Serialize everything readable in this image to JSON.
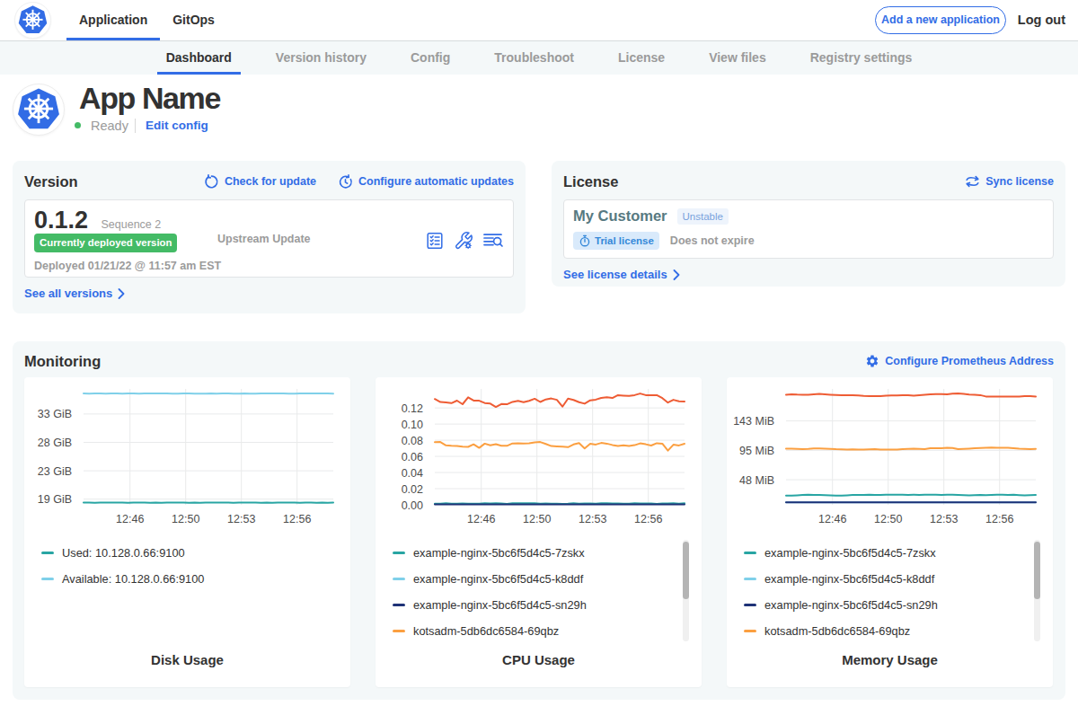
{
  "colors": {
    "accent_blue": "#326de6",
    "k8s_blue": "#326ce5",
    "green": "#44bb66",
    "card_bg": "#f4f8f9",
    "text_dark": "#323232",
    "text_gray": "#9b9b9b",
    "teal": "#28a5a3",
    "light_blue": "#7fd0e9",
    "navy": "#1e3277",
    "orange": "#fb9f40",
    "red_orange": "#ee5c34"
  },
  "topnav": {
    "logo_icon": "kubernetes-logo",
    "tabs": [
      {
        "label": "Application",
        "active": true
      },
      {
        "label": "GitOps",
        "active": false
      }
    ],
    "add_button_label": "Add a new application",
    "logout_label": "Log out"
  },
  "subnav": {
    "tabs": [
      {
        "label": "Dashboard",
        "active": true
      },
      {
        "label": "Version history",
        "active": false
      },
      {
        "label": "Config",
        "active": false
      },
      {
        "label": "Troubleshoot",
        "active": false
      },
      {
        "label": "License",
        "active": false
      },
      {
        "label": "View files",
        "active": false
      },
      {
        "label": "Registry settings",
        "active": false
      }
    ]
  },
  "app_header": {
    "name": "App Name",
    "status": "Ready",
    "edit_link": "Edit config"
  },
  "version_card": {
    "title": "Version",
    "check_update_label": "Check for update",
    "auto_update_label": "Configure automatic updates",
    "version_number": "0.1.2",
    "sequence": "Sequence 2",
    "deployed_badge": "Currently deployed version",
    "deployed_at": "Deployed 01/21/22 @ 11:57 am EST",
    "middle_label": "Upstream Update",
    "action_icons": [
      "preflight-checklist-icon",
      "wrench-gear-icon",
      "deploy-logs-icon"
    ],
    "see_all_label": "See all versions"
  },
  "license_card": {
    "title": "License",
    "sync_label": "Sync license",
    "customer": "My Customer",
    "channel": "Unstable",
    "type_badge": "Trial license",
    "expiry": "Does not expire",
    "see_details_label": "See license details"
  },
  "monitoring": {
    "title": "Monitoring",
    "configure_label": "Configure Prometheus Address"
  },
  "chart_data": [
    {
      "type": "line",
      "title": "Disk Usage",
      "ylim": [
        17.7,
        36.7
      ],
      "yticks": [
        {
          "value": 18.63,
          "label": "19 GiB"
        },
        {
          "value": 23.28,
          "label": "23 GiB"
        },
        {
          "value": 27.94,
          "label": "28 GiB"
        },
        {
          "value": 32.59,
          "label": "33 GiB"
        }
      ],
      "xticks": [
        {
          "frac": 0.186,
          "label": "12:46"
        },
        {
          "frac": 0.409,
          "label": "12:50"
        },
        {
          "frac": 0.632,
          "label": "12:53"
        },
        {
          "frac": 0.855,
          "label": "12:56"
        }
      ],
      "series": [
        {
          "name": "Available: 10.128.0.66:9100",
          "color": "#7fd0e9",
          "values": [
            35.961,
            35.935,
            35.949,
            35.952,
            35.941,
            35.965,
            35.947,
            35.938,
            35.952,
            35.959,
            35.938,
            35.942,
            35.97,
            35.956,
            35.948,
            35.951,
            35.935,
            35.939,
            35.944,
            35.954,
            35.939,
            35.939,
            35.933,
            35.955,
            35.939,
            35.966,
            35.964,
            35.933,
            35.94,
            35.957,
            35.939,
            35.935,
            35.967,
            35.953,
            35.949,
            35.961,
            35.962,
            35.938,
            35.934,
            35.947,
            35.947,
            35.949,
            35.959,
            35.957,
            35.969,
            35.934
          ]
        },
        {
          "name": "Used: 10.128.0.66:9100",
          "color": "#28a5a3",
          "values": [
            18.078,
            18.055,
            18.034,
            18.053,
            18.09,
            18.062,
            18.088,
            18.082,
            18.031,
            18.073,
            18.071,
            18.062,
            18.046,
            18.068,
            18.037,
            18.056,
            18.057,
            18.087,
            18.083,
            18.046,
            18.06,
            18.041,
            18.085,
            18.082,
            18.048,
            18.068,
            18.067,
            18.039,
            18.076,
            18.062,
            18.077,
            18.062,
            18.03,
            18.049,
            18.031,
            18.086,
            18.083,
            18.08,
            18.048,
            18.033,
            18.083,
            18.087,
            18.035,
            18.059,
            18.034,
            18.076
          ]
        }
      ],
      "legend": [
        {
          "color": "#28a5a3",
          "label": "Used: 10.128.0.66:9100"
        },
        {
          "color": "#7fd0e9",
          "label": "Available: 10.128.0.66:9100"
        }
      ],
      "scrollbar": false
    },
    {
      "type": "line",
      "title": "CPU Usage",
      "ylim": [
        0,
        0.1435
      ],
      "yticks": [
        {
          "value": 0.0,
          "label": "0.00"
        },
        {
          "value": 0.02,
          "label": "0.02"
        },
        {
          "value": 0.04,
          "label": "0.04"
        },
        {
          "value": 0.06,
          "label": "0.06"
        },
        {
          "value": 0.08,
          "label": "0.08"
        },
        {
          "value": 0.1,
          "label": "0.10"
        },
        {
          "value": 0.12,
          "label": "0.12"
        }
      ],
      "xticks": [
        {
          "frac": 0.186,
          "label": "12:46"
        },
        {
          "frac": 0.409,
          "label": "12:50"
        },
        {
          "frac": 0.632,
          "label": "12:53"
        },
        {
          "frac": 0.855,
          "label": "12:56"
        }
      ],
      "series": [
        {
          "name": "example-nginx-5bc6f5d4c5-k8ddf",
          "color": "#7fd0e9",
          "values": [
            0.001,
            0.001,
            0.001,
            0.001,
            0.001,
            0.001,
            0.001,
            0.001,
            0.001,
            0.001,
            0.001,
            0.001,
            0.001,
            0.001,
            0.001,
            0.001,
            0.001,
            0.001,
            0.001,
            0.001,
            0.001,
            0.001,
            0.001,
            0.001,
            0.001,
            0.001,
            0.001,
            0.001,
            0.001,
            0.001,
            0.001,
            0.001,
            0.001,
            0.001,
            0.001,
            0.001,
            0.001,
            0.001,
            0.001,
            0.001,
            0.001,
            0.001,
            0.001,
            0.001,
            0.001,
            0.001
          ]
        },
        {
          "name": "example-nginx-5bc6f5d4c5-7zskx",
          "color": "#28a5a3",
          "values": [
            0.0015,
            0.0015,
            0.0019,
            0.0014,
            0.0014,
            0.0016,
            0.0015,
            0.0014,
            0.0014,
            0.0019,
            0.0016,
            0.0019,
            0.0016,
            0.0012,
            0.002,
            0.0019,
            0.002,
            0.0019,
            0.0019,
            0.0013,
            0.0016,
            0.0014,
            0.0015,
            0.0012,
            0.0015,
            0.002,
            0.0014,
            0.0018,
            0.0016,
            0.0015,
            0.002,
            0.002,
            0.0016,
            0.0018,
            0.0013,
            0.0014,
            0.002,
            0.0017,
            0.0016,
            0.0018,
            0.0012,
            0.0017,
            0.0016,
            0.0019,
            0.0013,
            0.002
          ]
        },
        {
          "name": "example-nginx-5bc6f5d4c5-sn29h",
          "color": "#1e3277",
          "values": [
            0.0007,
            0.0007,
            0.0007,
            0.0007,
            0.0007,
            0.0007,
            0.0007,
            0.0007,
            0.0007,
            0.0007,
            0.0007,
            0.0007,
            0.0007,
            0.0007,
            0.0007,
            0.0007,
            0.0007,
            0.0007,
            0.0007,
            0.0007,
            0.0007,
            0.0007,
            0.0007,
            0.0007,
            0.0007,
            0.0007,
            0.0007,
            0.0007,
            0.0007,
            0.0007,
            0.0007,
            0.0007,
            0.0007,
            0.0007,
            0.0007,
            0.0007,
            0.0007,
            0.0007,
            0.0007,
            0.0007,
            0.0007,
            0.0007,
            0.0007,
            0.0007,
            0.0007,
            0.0007
          ]
        },
        {
          "name": "kotsadm-5db6dc6584-69qbz",
          "color": "#fb9f40",
          "values": [
            0.0775,
            0.0778,
            0.0736,
            0.0732,
            0.073,
            0.0721,
            0.0718,
            0.0749,
            0.0705,
            0.0757,
            0.0736,
            0.0751,
            0.0732,
            0.0731,
            0.076,
            0.0762,
            0.0759,
            0.0763,
            0.0774,
            0.0778,
            0.0753,
            0.0727,
            0.0724,
            0.072,
            0.0714,
            0.0747,
            0.0765,
            0.0699,
            0.0755,
            0.0746,
            0.0767,
            0.0757,
            0.0741,
            0.073,
            0.0738,
            0.0729,
            0.0739,
            0.0761,
            0.075,
            0.0734,
            0.0763,
            0.0757,
            0.0672,
            0.0744,
            0.0735,
            0.0756
          ]
        },
        {
          "color": "#ee5c34",
          "values": [
            0.131,
            0.1273,
            0.1267,
            0.1259,
            0.129,
            0.1246,
            0.1331,
            0.1291,
            0.1289,
            0.126,
            0.1254,
            0.1211,
            0.1248,
            0.1245,
            0.1275,
            0.1287,
            0.1272,
            0.1288,
            0.1314,
            0.1274,
            0.1305,
            0.1317,
            0.13,
            0.1216,
            0.1316,
            0.1299,
            0.1271,
            0.1253,
            0.1294,
            0.1303,
            0.1324,
            0.1331,
            0.1323,
            0.1358,
            0.1353,
            0.1348,
            0.1358,
            0.1378,
            0.1358,
            0.1358,
            0.1358,
            0.1322,
            0.1266,
            0.13,
            0.1281,
            0.1279
          ]
        }
      ],
      "legend": [
        {
          "color": "#28a5a3",
          "label": "example-nginx-5bc6f5d4c5-7zskx"
        },
        {
          "color": "#7fd0e9",
          "label": "example-nginx-5bc6f5d4c5-k8ddf"
        },
        {
          "color": "#1e3277",
          "label": "example-nginx-5bc6f5d4c5-sn29h"
        },
        {
          "color": "#fb9f40",
          "label": "kotsadm-5db6dc6584-69qbz"
        }
      ],
      "scrollbar": true
    },
    {
      "type": "line",
      "title": "Memory Usage",
      "ylim": [
        7,
        195
      ],
      "yticks": [
        {
          "value": 47.7,
          "label": "48 MiB"
        },
        {
          "value": 95.4,
          "label": "95 MiB"
        },
        {
          "value": 143.1,
          "label": "143 MiB"
        }
      ],
      "xticks": [
        {
          "frac": 0.186,
          "label": "12:46"
        },
        {
          "frac": 0.409,
          "label": "12:50"
        },
        {
          "frac": 0.632,
          "label": "12:53"
        },
        {
          "frac": 0.855,
          "label": "12:56"
        }
      ],
      "series": [
        {
          "name": "example-nginx-5bc6f5d4c5-k8ddf",
          "color": "#7fd0e9",
          "values": [
            11,
            11,
            11,
            11,
            11,
            11,
            11,
            11,
            11,
            11,
            11,
            11,
            11,
            11,
            11,
            11,
            11,
            11,
            11,
            11,
            11,
            11,
            11,
            11,
            11,
            11,
            11,
            11,
            11,
            11,
            11,
            11,
            11,
            11,
            11,
            11,
            11,
            11,
            11,
            11,
            11,
            11,
            11,
            11,
            11,
            11
          ]
        },
        {
          "name": "example-nginx-5bc6f5d4c5-7zskx",
          "color": "#28a5a3",
          "values": [
            22.0,
            22.0,
            22.5,
            23.1,
            23.4,
            23.2,
            22.9,
            22.6,
            22.2,
            21.9,
            22.0,
            22.5,
            22.9,
            22.9,
            23.1,
            23.4,
            22.9,
            23.1,
            23.4,
            23.4,
            23.4,
            23.4,
            23.0,
            23.3,
            23.1,
            23.4,
            23.4,
            23.3,
            23.2,
            23.4,
            23.4,
            23.0,
            22.6,
            22.1,
            22.6,
            23.0,
            22.6,
            23.0,
            23.4,
            23.4,
            23.2,
            23.3,
            22.8,
            22.3,
            22.8,
            23.0
          ]
        },
        {
          "name": "example-nginx-5bc6f5d4c5-sn29h",
          "color": "#1e3277",
          "values": [
            11,
            11,
            11,
            11,
            11,
            11,
            11,
            11,
            11,
            11,
            11,
            11,
            11,
            11,
            11,
            11,
            11,
            11,
            11,
            11,
            11,
            11,
            11,
            11,
            11,
            11,
            11,
            11,
            11,
            11,
            11,
            11,
            11,
            11,
            11,
            11,
            11,
            11,
            11,
            11,
            11,
            11,
            11,
            11,
            11,
            11
          ]
        },
        {
          "name": "kotsadm-5db6dc6584-69qbz",
          "color": "#fb9f40",
          "values": [
            98.2,
            97.9,
            97.7,
            97.2,
            97.7,
            98.4,
            98.4,
            98.3,
            97.8,
            97.2,
            97.0,
            96.6,
            97.1,
            96.6,
            96.5,
            97.1,
            97.2,
            96.7,
            96.7,
            96.5,
            96.5,
            97.2,
            97.7,
            98.0,
            97.7,
            97.5,
            98.6,
            99.0,
            99.0,
            99.4,
            99.2,
            97.2,
            97.6,
            98.3,
            98.8,
            99.2,
            99.7,
            100.0,
            99.6,
            99.7,
            99.5,
            98.8,
            98.1,
            97.8,
            97.5,
            97.8
          ]
        },
        {
          "color": "#ee5c34",
          "values": [
            185.6,
            186.2,
            185.8,
            185.7,
            185.4,
            186.1,
            186.9,
            186.3,
            185.7,
            185.2,
            184.8,
            184.7,
            184.9,
            184.5,
            183.6,
            183.4,
            183.2,
            183.3,
            184.1,
            184.5,
            184.5,
            184.7,
            185.0,
            184.2,
            184.9,
            185.5,
            186.1,
            186.7,
            186.5,
            186.3,
            187.4,
            187.6,
            186.8,
            186.0,
            185.5,
            184.9,
            182.8,
            182.5,
            182.5,
            182.5,
            182.5,
            182.5,
            182.5,
            183.2,
            183.4,
            182.7
          ]
        }
      ],
      "legend": [
        {
          "color": "#28a5a3",
          "label": "example-nginx-5bc6f5d4c5-7zskx"
        },
        {
          "color": "#7fd0e9",
          "label": "example-nginx-5bc6f5d4c5-k8ddf"
        },
        {
          "color": "#1e3277",
          "label": "example-nginx-5bc6f5d4c5-sn29h"
        },
        {
          "color": "#fb9f40",
          "label": "kotsadm-5db6dc6584-69qbz"
        }
      ],
      "scrollbar": true
    }
  ]
}
